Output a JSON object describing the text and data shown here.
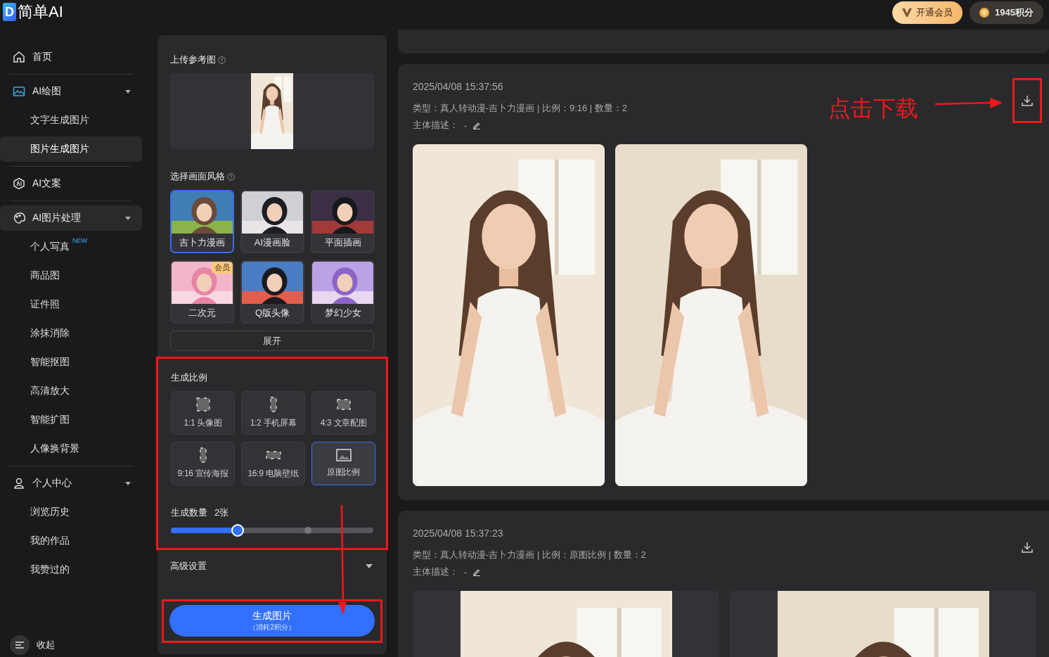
{
  "header": {
    "logo_mark": "D",
    "logo_text": "简单AI",
    "vip_button": "开通会员",
    "points": "1945积分"
  },
  "sidebar": {
    "items": [
      {
        "label": "首页",
        "kind": "home",
        "selected": false
      },
      {
        "label": "AI绘图",
        "kind": "picture",
        "selected": false,
        "expanded": true,
        "children": [
          {
            "label": "文字生成图片",
            "selected": false
          },
          {
            "label": "图片生成图片",
            "selected": true
          }
        ]
      },
      {
        "label": "AI文案",
        "kind": "hexagon",
        "selected": false
      },
      {
        "label": "AI图片处理",
        "kind": "palette",
        "selected": true,
        "expanded": true,
        "children": [
          {
            "label": "个人写真",
            "badge": "NEW",
            "selected": false
          },
          {
            "label": "商品图",
            "selected": false
          },
          {
            "label": "证件照",
            "selected": false
          },
          {
            "label": "涂抹消除",
            "selected": false
          },
          {
            "label": "智能抠图",
            "selected": false
          },
          {
            "label": "高清放大",
            "selected": false
          },
          {
            "label": "智能扩图",
            "selected": false
          },
          {
            "label": "人像换背景",
            "selected": false
          }
        ]
      },
      {
        "label": "个人中心",
        "kind": "user",
        "selected": false,
        "expanded": true,
        "children": [
          {
            "label": "浏览历史",
            "selected": false
          },
          {
            "label": "我的作品",
            "selected": false
          },
          {
            "label": "我赞过的",
            "selected": false
          }
        ]
      }
    ],
    "collapse": "收起"
  },
  "panel": {
    "upload": {
      "label": "上传参考图"
    },
    "style": {
      "label": "选择画面风格",
      "items": [
        {
          "label": "吉卜力漫画",
          "selected": true
        },
        {
          "label": "AI漫画脸",
          "selected": false
        },
        {
          "label": "平面插画",
          "selected": false
        },
        {
          "label": "二次元",
          "selected": false,
          "badge": "会员"
        },
        {
          "label": "Q版头像",
          "selected": false
        },
        {
          "label": "梦幻少女",
          "selected": false
        }
      ],
      "expand": "展开"
    },
    "ratio": {
      "label": "生成比例",
      "highlighted": true,
      "items": [
        {
          "kind": "square",
          "label": "1:1 头像图",
          "selected": false
        },
        {
          "kind": "tall",
          "label": "1:2 手机屏幕",
          "selected": false
        },
        {
          "kind": "landscape",
          "label": "4:3 文章配图",
          "selected": false
        },
        {
          "kind": "portrait",
          "label": "9:16 宣传海报",
          "selected": false
        },
        {
          "kind": "wide",
          "label": "16:9 电脑壁纸",
          "selected": false
        },
        {
          "kind": "original",
          "label": "原图比例",
          "selected": true
        }
      ]
    },
    "count": {
      "label": "生成数量",
      "value": "2张",
      "level": 0.33
    },
    "advanced": {
      "label": "高级设置",
      "expanded": false
    },
    "generate": {
      "label": "生成图片",
      "cost": "（消耗2积分）",
      "highlighted": true
    }
  },
  "results": [
    {
      "time": "2025/04/08 15:37:56",
      "info": "类型：真人转动漫-吉卜力漫画 | 比例：9:16 | 数量：2",
      "subject_label": "主体描述：",
      "subject": "-",
      "highlighted": true,
      "images": [
        {
          "kind": "full"
        },
        {
          "kind": "full"
        }
      ]
    },
    {
      "time": "2025/04/08 15:37:23",
      "info": "类型：真人转动漫-吉卜力漫画 | 比例：原图比例 | 数量：2",
      "subject_label": "主体描述：",
      "subject": "-",
      "highlighted": false,
      "images": [
        {
          "kind": "framed"
        },
        {
          "kind": "framed"
        }
      ]
    }
  ],
  "annotation": {
    "label": "点击下载"
  }
}
